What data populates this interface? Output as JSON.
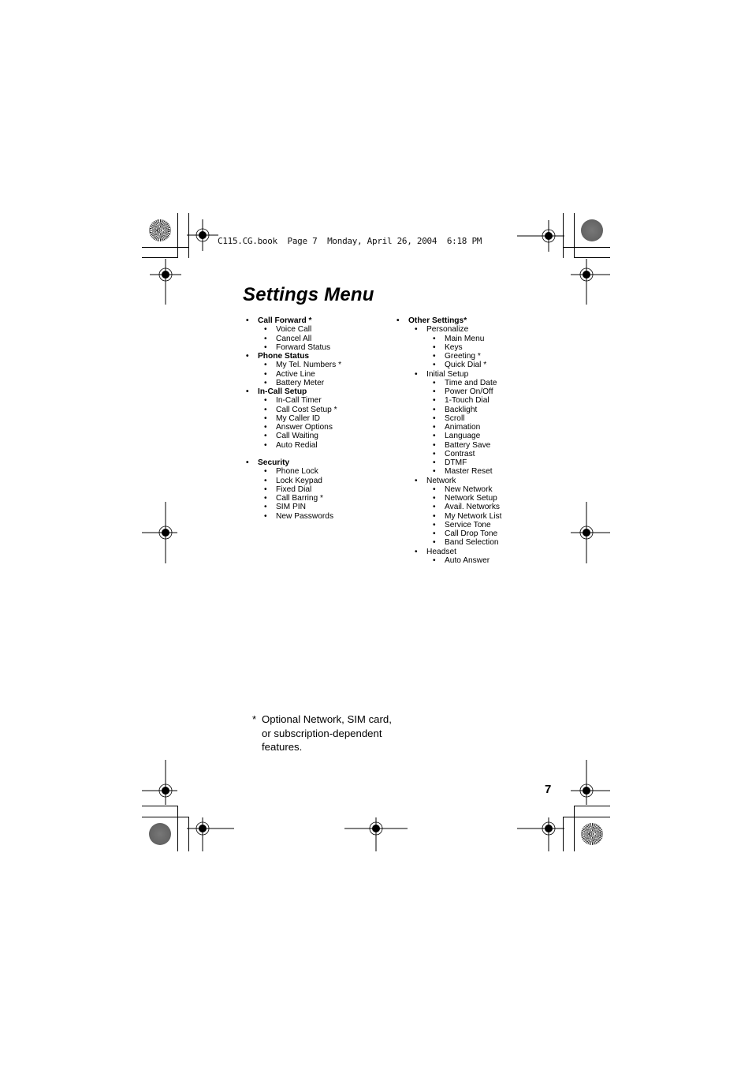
{
  "print_header": "C115.CG.book  Page 7  Monday, April 26, 2004  6:18 PM",
  "title": "Settings Menu",
  "left_column": [
    {
      "label": "Call Forward *",
      "level": 0
    },
    {
      "label": "Voice Call",
      "level": 1
    },
    {
      "label": "Cancel All",
      "level": 1
    },
    {
      "label": "Forward Status",
      "level": 1
    },
    {
      "label": "Phone Status",
      "level": 0
    },
    {
      "label": "My Tel. Numbers *",
      "level": 1
    },
    {
      "label": "Active Line",
      "level": 1
    },
    {
      "label": "Battery Meter",
      "level": 1
    },
    {
      "label": "In-Call Setup",
      "level": 0
    },
    {
      "label": "In-Call Timer",
      "level": 1
    },
    {
      "label": "Call Cost Setup *",
      "level": 1
    },
    {
      "label": "My Caller ID",
      "level": 1
    },
    {
      "label": "Answer Options",
      "level": 1
    },
    {
      "label": "Call Waiting",
      "level": 1
    },
    {
      "label": "Auto Redial",
      "level": 1
    },
    {
      "label": "",
      "level": -1
    },
    {
      "label": "Security",
      "level": 0
    },
    {
      "label": "Phone Lock",
      "level": 1
    },
    {
      "label": "Lock Keypad",
      "level": 1
    },
    {
      "label": "Fixed Dial",
      "level": 1
    },
    {
      "label": "Call Barring *",
      "level": 1
    },
    {
      "label": "SIM PIN",
      "level": 1
    },
    {
      "label": "New Passwords",
      "level": 1
    }
  ],
  "right_column": [
    {
      "label": "Other Settings*",
      "level": 0
    },
    {
      "label": "Personalize",
      "level": 1
    },
    {
      "label": "Main Menu",
      "level": 2
    },
    {
      "label": "Keys",
      "level": 2
    },
    {
      "label": "Greeting *",
      "level": 2
    },
    {
      "label": "Quick Dial *",
      "level": 2
    },
    {
      "label": "Initial Setup",
      "level": 1
    },
    {
      "label": "Time and Date",
      "level": 2
    },
    {
      "label": "Power On/Off",
      "level": 2
    },
    {
      "label": "1-Touch Dial",
      "level": 2
    },
    {
      "label": "Backlight",
      "level": 2
    },
    {
      "label": "Scroll",
      "level": 2
    },
    {
      "label": "Animation",
      "level": 2
    },
    {
      "label": "Language",
      "level": 2
    },
    {
      "label": "Battery Save",
      "level": 2
    },
    {
      "label": "Contrast",
      "level": 2
    },
    {
      "label": "DTMF",
      "level": 2
    },
    {
      "label": "Master Reset",
      "level": 2
    },
    {
      "label": "Network",
      "level": 1
    },
    {
      "label": "New Network",
      "level": 2
    },
    {
      "label": "Network Setup",
      "level": 2
    },
    {
      "label": "Avail. Networks",
      "level": 2
    },
    {
      "label": "My Network List",
      "level": 2
    },
    {
      "label": "Service Tone",
      "level": 2
    },
    {
      "label": "Call Drop Tone",
      "level": 2
    },
    {
      "label": "Band Selection",
      "level": 2
    },
    {
      "label": "Headset",
      "level": 1
    },
    {
      "label": "Auto Answer",
      "level": 2
    }
  ],
  "bullet_glyph": "•",
  "footnote": {
    "marker": "*",
    "text": "Optional Network, SIM card, or subscription-dependent features."
  },
  "page_number": "7",
  "icons": {
    "registration_mark": "registration-mark-icon",
    "color_bar_gray": "gray-density-patch-icon",
    "color_bar_star": "star-target-patch-icon"
  }
}
